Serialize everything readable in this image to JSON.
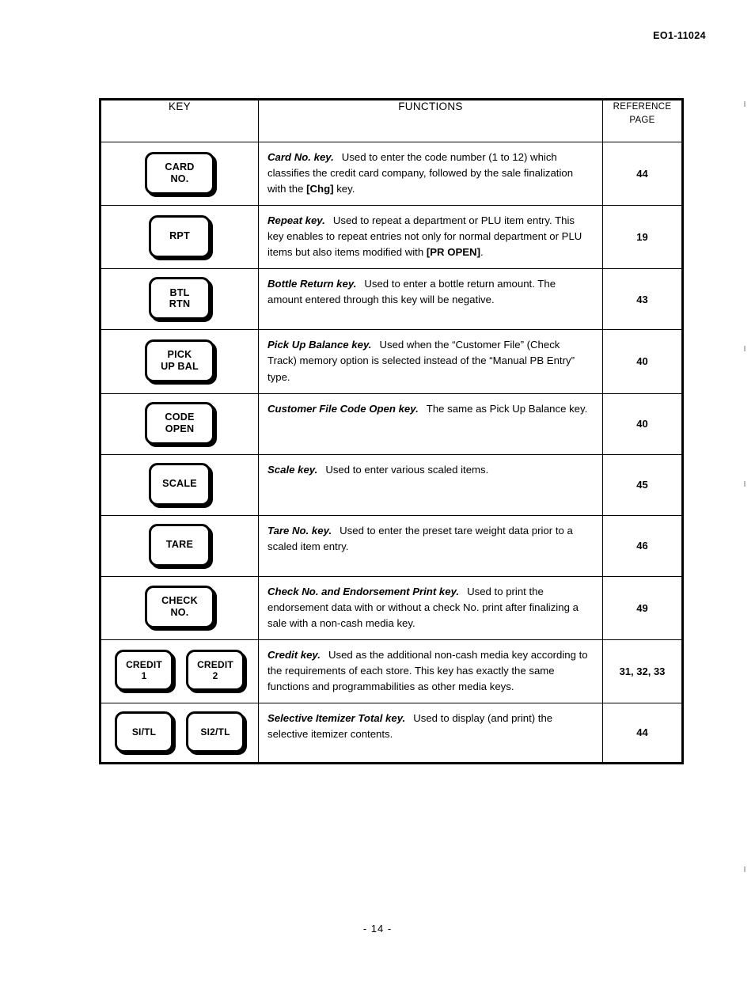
{
  "header": {
    "doc_code": "EO1-11024"
  },
  "footer": {
    "page_number": "- 14 -"
  },
  "table": {
    "headers": {
      "key": "KEY",
      "functions": "FUNCTIONS",
      "reference_line1": "REFERENCE",
      "reference_line2": "PAGE"
    },
    "rows": [
      {
        "keys": [
          {
            "lines": [
              "CARD",
              "NO."
            ]
          }
        ],
        "lead": "Card No. key.",
        "body_before": "Used to enter the code number (1 to 12) which classifies the credit card company, followed by the sale finalization with the ",
        "body_bold": "[Chg]",
        "body_after": " key.",
        "reference": "44"
      },
      {
        "keys": [
          {
            "lines": [
              "RPT"
            ]
          }
        ],
        "lead": "Repeat key.",
        "body_before": "Used to repeat a department or PLU item entry.   This key enables to repeat entries not only for normal department or PLU items but also items modified with ",
        "body_bold": "[PR OPEN]",
        "body_after": ".",
        "reference": "19"
      },
      {
        "keys": [
          {
            "lines": [
              "BTL",
              "RTN"
            ]
          }
        ],
        "lead": "Bottle Return key.",
        "body_before": "Used to enter a bottle return amount.  The amount entered through this key will be negative.",
        "body_bold": "",
        "body_after": "",
        "reference": "43"
      },
      {
        "keys": [
          {
            "lines": [
              "PICK",
              "UP BAL"
            ]
          }
        ],
        "lead": "Pick Up Balance key.",
        "body_before": "Used when the “Customer File” (Check Track) memory option is selected instead of the “Manual PB Entry” type.",
        "body_bold": "",
        "body_after": "",
        "reference": "40"
      },
      {
        "keys": [
          {
            "lines": [
              "CODE",
              "OPEN"
            ]
          }
        ],
        "lead": "Customer File Code Open key.",
        "body_before": "The same as Pick Up Balance key.",
        "body_bold": "",
        "body_after": "",
        "reference": "40"
      },
      {
        "keys": [
          {
            "lines": [
              "SCALE"
            ]
          }
        ],
        "lead": "Scale key.",
        "body_before": "Used to enter various scaled items.",
        "body_bold": "",
        "body_after": "",
        "reference": "45"
      },
      {
        "keys": [
          {
            "lines": [
              "TARE"
            ]
          }
        ],
        "lead": "Tare No. key.",
        "body_before": "Used to enter the preset tare weight data prior to a scaled item entry.",
        "body_bold": "",
        "body_after": "",
        "reference": "46"
      },
      {
        "keys": [
          {
            "lines": [
              "CHECK",
              "NO."
            ]
          }
        ],
        "lead": "Check No. and Endorsement Print key.",
        "body_before": "Used to print the endorsement data with or without a check No. print after finalizing a sale with a non-cash media key.",
        "body_bold": "",
        "body_after": "",
        "reference": "49"
      },
      {
        "keys": [
          {
            "lines": [
              "CREDIT",
              "1"
            ]
          },
          {
            "lines": [
              "CREDIT",
              "2"
            ]
          }
        ],
        "lead": "Credit key.",
        "body_before": "Used as the additional non-cash media key according to the requirements of each store.   This key has exactly the same functions and programmabilities as other media keys.",
        "body_bold": "",
        "body_after": "",
        "reference": "31, 32, 33"
      },
      {
        "keys": [
          {
            "lines": [
              "SI/TL"
            ]
          },
          {
            "lines": [
              "SI2/TL"
            ]
          }
        ],
        "lead": "Selective Itemizer Total key.",
        "body_before": "Used to display (and print) the selective itemizer contents.",
        "body_bold": "",
        "body_after": "",
        "reference": "44"
      }
    ]
  }
}
